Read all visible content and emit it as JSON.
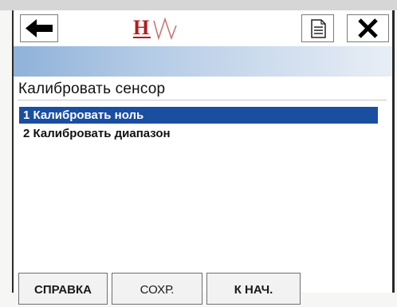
{
  "toolbar": {
    "back_icon": "arrow-left-icon",
    "logo_text": "H",
    "logo_colors": {
      "h": "#b21d1d",
      "wave": "#c97070"
    },
    "doc_icon": "document-icon",
    "close_icon": "close-icon"
  },
  "screen": {
    "title": "Калибровать сенсор",
    "menu": [
      {
        "label": "1 Калибровать ноль",
        "selected": true
      },
      {
        "label": "2 Калибровать диапазон",
        "selected": false
      }
    ]
  },
  "softkeys": {
    "help": "СПРАВКА",
    "save": "СОХР.",
    "home": "К НАЧ."
  },
  "colors": {
    "selection": "#1a4ea0",
    "header_gradient_start": "#8fb2d9",
    "header_gradient_end": "#e8eef6"
  }
}
